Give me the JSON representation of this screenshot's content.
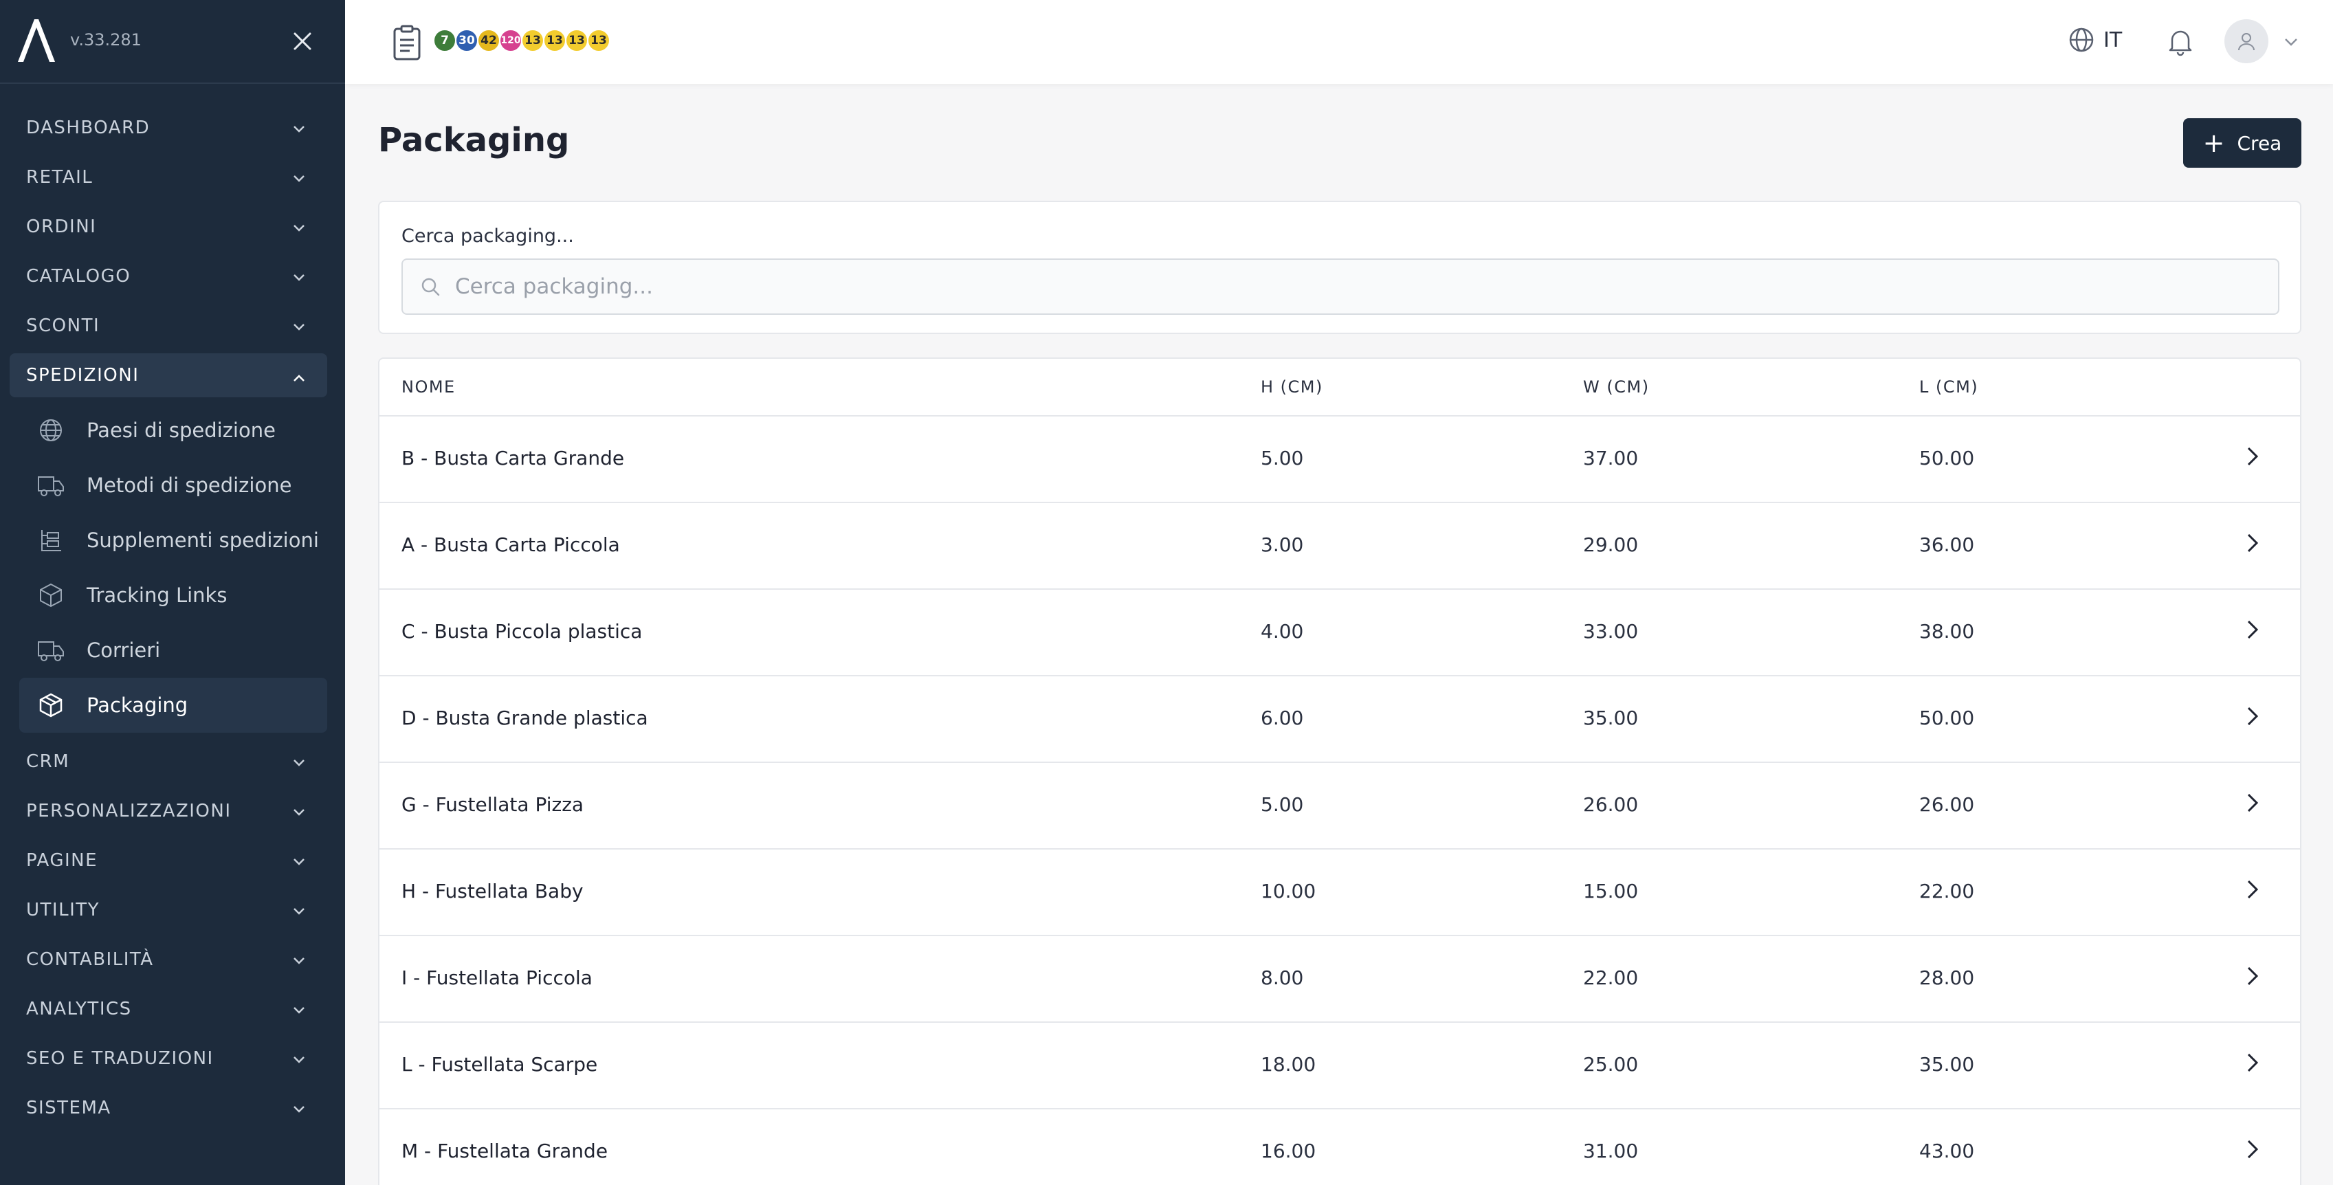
{
  "sidebar": {
    "version": "v.33.281",
    "nav": [
      {
        "label": "DASHBOARD"
      },
      {
        "label": "RETAIL"
      },
      {
        "label": "ORDINI"
      },
      {
        "label": "CATALOGO"
      },
      {
        "label": "SCONTI"
      },
      {
        "label": "SPEDIZIONI"
      },
      {
        "label": "CRM"
      },
      {
        "label": "PERSONALIZZAZIONI"
      },
      {
        "label": "PAGINE"
      },
      {
        "label": "UTILITY"
      },
      {
        "label": "CONTABILITÀ"
      },
      {
        "label": "ANALYTICS"
      },
      {
        "label": "SEO E TRADUZIONI"
      },
      {
        "label": "SISTEMA"
      }
    ],
    "sub": [
      {
        "label": "Paesi di spedizione",
        "icon": "globe-icon"
      },
      {
        "label": "Metodi di spedizione",
        "icon": "truck-icon"
      },
      {
        "label": "Supplementi spedizioni",
        "icon": "supplements-icon"
      },
      {
        "label": "Tracking Links",
        "icon": "box-icon"
      },
      {
        "label": "Corrieri",
        "icon": "truck-icon"
      },
      {
        "label": "Packaging",
        "icon": "package-icon"
      }
    ]
  },
  "topbar": {
    "badges": [
      {
        "value": "7",
        "color": "#3e7d3a"
      },
      {
        "value": "30",
        "color": "#2f5fb0"
      },
      {
        "value": "42",
        "color": "#e5b81e"
      },
      {
        "value": "120",
        "color": "#d6418f"
      },
      {
        "value": "13",
        "color": "#f2cc2e"
      },
      {
        "value": "13",
        "color": "#f2cc2e"
      },
      {
        "value": "13",
        "color": "#f2cc2e"
      },
      {
        "value": "13",
        "color": "#f2cc2e"
      }
    ],
    "language": "IT"
  },
  "main": {
    "title": "Packaging",
    "create_label": "Crea",
    "search_label": "Cerca packaging...",
    "search_placeholder": "Cerca packaging...",
    "columns": [
      "NOME",
      "H (CM)",
      "W (CM)",
      "L (CM)"
    ],
    "rows": [
      {
        "name": "B - Busta Carta Grande",
        "h": "5.00",
        "w": "37.00",
        "l": "50.00"
      },
      {
        "name": "A - Busta Carta Piccola",
        "h": "3.00",
        "w": "29.00",
        "l": "36.00"
      },
      {
        "name": "C - Busta Piccola plastica",
        "h": "4.00",
        "w": "33.00",
        "l": "38.00"
      },
      {
        "name": "D - Busta Grande plastica",
        "h": "6.00",
        "w": "35.00",
        "l": "50.00"
      },
      {
        "name": "G - Fustellata Pizza",
        "h": "5.00",
        "w": "26.00",
        "l": "26.00"
      },
      {
        "name": "H - Fustellata Baby",
        "h": "10.00",
        "w": "15.00",
        "l": "22.00"
      },
      {
        "name": "I - Fustellata Piccola",
        "h": "8.00",
        "w": "22.00",
        "l": "28.00"
      },
      {
        "name": "L - Fustellata Scarpe",
        "h": "18.00",
        "w": "25.00",
        "l": "35.00"
      },
      {
        "name": "M - Fustellata Grande",
        "h": "16.00",
        "w": "31.00",
        "l": "43.00"
      }
    ]
  }
}
